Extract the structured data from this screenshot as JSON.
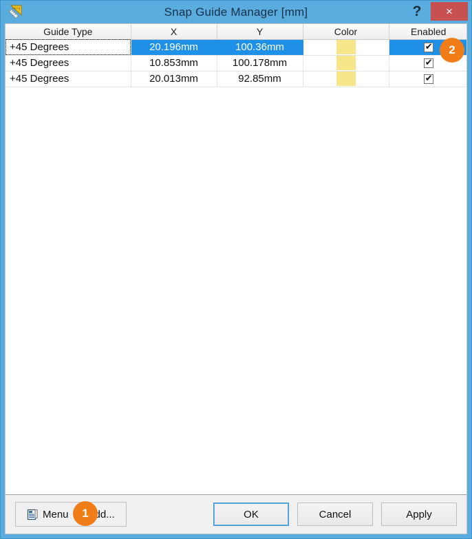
{
  "window": {
    "title": "Snap Guide Manager [mm]",
    "app_icon": "set-square-ruler-icon",
    "help_label": "?",
    "close_label": "×",
    "chrome_color": "#5aacdf",
    "close_color": "#c75050"
  },
  "grid": {
    "columns": [
      "Guide Type",
      "X",
      "Y",
      "Color",
      "Enabled"
    ],
    "rows": [
      {
        "guide_type": "+45 Degrees",
        "x": "20.196mm",
        "y": "100.36mm",
        "color": "#f7e58a",
        "enabled": true,
        "selected": true
      },
      {
        "guide_type": "+45 Degrees",
        "x": "10.853mm",
        "y": "100.178mm",
        "color": "#f7e58a",
        "enabled": true,
        "selected": false
      },
      {
        "guide_type": "+45 Degrees",
        "x": "20.013mm",
        "y": "92.85mm",
        "color": "#f7e58a",
        "enabled": true,
        "selected": false
      }
    ],
    "selection_color": "#1e90e8"
  },
  "bottom_bar": {
    "menu_label": "Menu",
    "menu_icon": "document-list-icon",
    "add_label": "Add...",
    "ok_label": "OK",
    "cancel_label": "Cancel",
    "apply_label": "Apply"
  },
  "annotations": {
    "badge_color": "#f07d18",
    "badge_1": "1",
    "badge_2": "2"
  }
}
